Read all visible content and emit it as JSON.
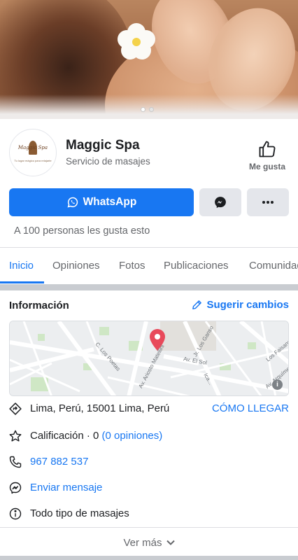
{
  "page": {
    "name": "Maggic Spa",
    "category": "Servicio de masajes",
    "logo_text": "Maggic Spa",
    "logo_tagline": "Tu lugar mágico para relajarte",
    "like_label": "Me gusta",
    "likes_summary": "A 100 personas les gusta esto"
  },
  "cover": {
    "slide_count": 2,
    "active_slide": 1
  },
  "actions": {
    "whatsapp_label": "WhatsApp",
    "messenger_icon": "messenger-icon",
    "more_icon": "more-icon"
  },
  "tabs": [
    {
      "label": "Inicio",
      "active": true
    },
    {
      "label": "Opiniones",
      "active": false
    },
    {
      "label": "Fotos",
      "active": false
    },
    {
      "label": "Publicaciones",
      "active": false
    },
    {
      "label": "Comunidad",
      "active": false
    }
  ],
  "info": {
    "title": "Información",
    "suggest_label": "Sugerir cambios",
    "map_labels": {
      "street1": "C. Los Poetas",
      "street2": "Av. Ariosto Matellini",
      "street3": "Av. El Sol",
      "street4": "Ica...",
      "street5": "Av. Arquímedes",
      "street6": "Los Faisanes",
      "street7": "Jr. Los Ganso"
    },
    "address": "Lima, Perú, 15001 Lima, Perú",
    "directions_label": "CÓMO LLEGAR",
    "rating_text": "Calificación · 0",
    "rating_link": "(0 opiniones)",
    "phone": "967 882 537",
    "message_label": "Enviar mensaje",
    "description": "Todo tipo de masajes",
    "see_more_label": "Ver más"
  },
  "colors": {
    "accent": "#1877f2",
    "pin": "#e8495a",
    "muted_text": "#65676b",
    "separator": "#c9ccd1"
  }
}
